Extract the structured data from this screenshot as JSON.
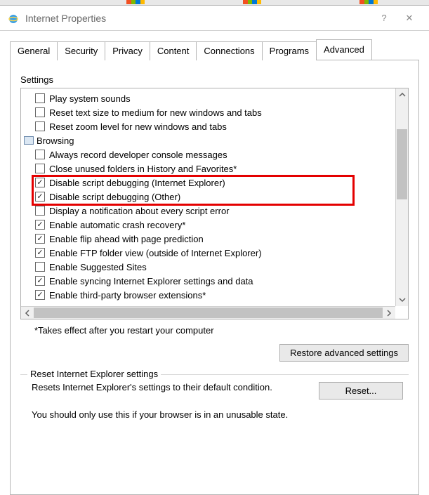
{
  "window": {
    "title": "Internet Properties",
    "help": "?",
    "close": "✕"
  },
  "tabs": [
    "General",
    "Security",
    "Privacy",
    "Content",
    "Connections",
    "Programs",
    "Advanced"
  ],
  "active_tab": "Advanced",
  "settings_label": "Settings",
  "tree": [
    {
      "type": "item",
      "checked": false,
      "label": "Play system sounds"
    },
    {
      "type": "item",
      "checked": false,
      "label": "Reset text size to medium for new windows and tabs"
    },
    {
      "type": "item",
      "checked": false,
      "label": "Reset zoom level for new windows and tabs"
    },
    {
      "type": "category",
      "label": "Browsing"
    },
    {
      "type": "item",
      "checked": false,
      "label": "Always record developer console messages"
    },
    {
      "type": "item",
      "checked": false,
      "label": "Close unused folders in History and Favorites*"
    },
    {
      "type": "item",
      "checked": true,
      "label": "Disable script debugging (Internet Explorer)",
      "hl": true
    },
    {
      "type": "item",
      "checked": true,
      "label": "Disable script debugging (Other)",
      "hl": true
    },
    {
      "type": "item",
      "checked": false,
      "label": "Display a notification about every script error"
    },
    {
      "type": "item",
      "checked": true,
      "label": "Enable automatic crash recovery*"
    },
    {
      "type": "item",
      "checked": true,
      "label": "Enable flip ahead with page prediction"
    },
    {
      "type": "item",
      "checked": true,
      "label": "Enable FTP folder view (outside of Internet Explorer)"
    },
    {
      "type": "item",
      "checked": false,
      "label": "Enable Suggested Sites"
    },
    {
      "type": "item",
      "checked": true,
      "label": "Enable syncing Internet Explorer settings and data"
    },
    {
      "type": "item",
      "checked": true,
      "label": "Enable third-party browser extensions*"
    }
  ],
  "restart_note": "*Takes effect after you restart your computer",
  "restore_btn": "Restore advanced settings",
  "reset_group": {
    "legend": "Reset Internet Explorer settings",
    "desc": "Resets Internet Explorer's settings to their default condition.",
    "btn": "Reset...",
    "warn": "You should only use this if your browser is in an unusable state."
  }
}
